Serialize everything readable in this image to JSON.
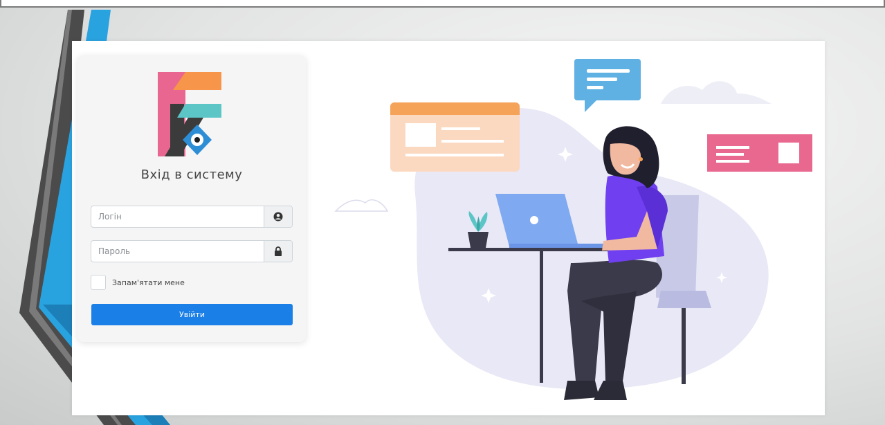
{
  "login": {
    "title": "Вхід в систему",
    "login_placeholder": "Логін",
    "password_placeholder": "Пароль",
    "remember_label": "Запам'ятати мене",
    "submit_label": "Увійти"
  },
  "colors": {
    "primary": "#1a7fe6",
    "logo_pink": "#e8668f",
    "logo_orange": "#f7954a",
    "logo_teal": "#5cc5c6",
    "logo_dark": "#3b3b3b",
    "logo_blue": "#2d8ed6",
    "deco_blue": "#29a3e0",
    "deco_dark": "#444444"
  },
  "icons": {
    "login_addon": "user-circle-icon",
    "password_addon": "lock-icon"
  }
}
